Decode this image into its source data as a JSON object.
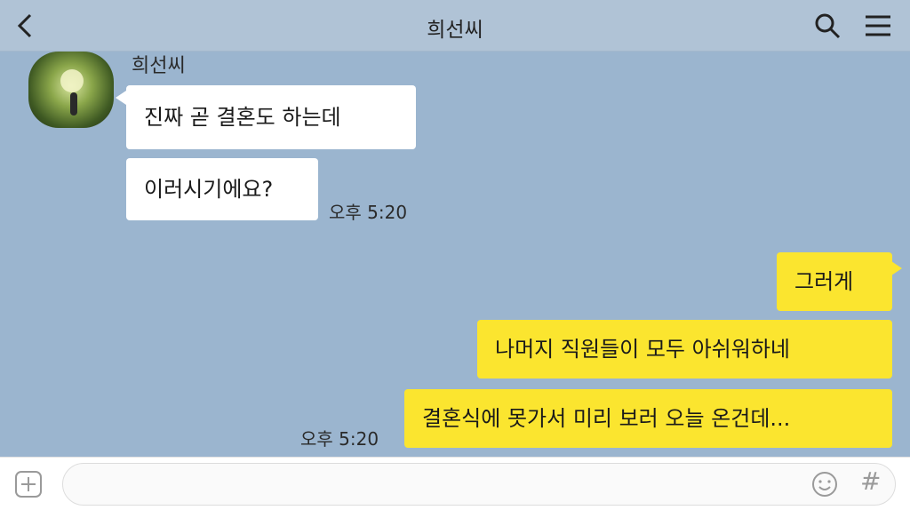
{
  "header": {
    "title": "희선씨",
    "back_icon": "chevron-left-icon",
    "search_icon": "search-icon",
    "menu_icon": "menu-icon"
  },
  "messages": {
    "sender_name": "희선씨",
    "incoming": [
      {
        "text": "진짜 곧 결혼도 하는데"
      },
      {
        "text": "이러시기에요?"
      }
    ],
    "incoming_time": "오후 5:20",
    "outgoing": [
      {
        "text": "그러게"
      },
      {
        "text": "나머지 직원들이 모두 아쉬워하네"
      },
      {
        "text": "결혼식에 못가서 미리 보러 오늘 온건데..."
      }
    ],
    "outgoing_time": "오후 5:20"
  },
  "composer": {
    "placeholder": "",
    "value": "",
    "plus_icon": "plus-icon",
    "emoji_icon": "emoji-icon",
    "hash_label": "#"
  },
  "colors": {
    "chat_background": "#9bb5cf",
    "outgoing_bubble": "#fbe52f",
    "incoming_bubble": "#ffffff"
  }
}
